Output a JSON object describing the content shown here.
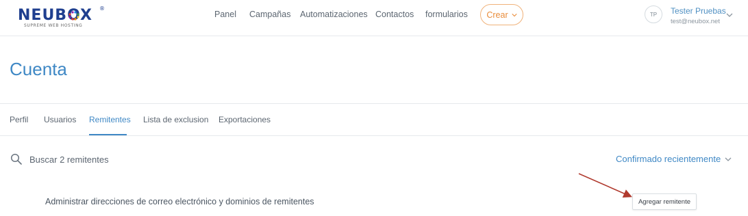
{
  "header": {
    "logo": {
      "text": "NEUBOX",
      "registered": "®",
      "tagline": "SUPREME WEB HOSTING"
    },
    "nav": [
      {
        "label": "Panel"
      },
      {
        "label": "Campañas"
      },
      {
        "label": "Automatizaciones"
      },
      {
        "label": "Contactos"
      },
      {
        "label": "formularios"
      }
    ],
    "create_button": {
      "label": "Crear",
      "icon": "chevron-down-icon"
    },
    "user": {
      "initials": "TP",
      "name": "Tester Pruebas",
      "email": "test@neubox.net",
      "menu_icon": "chevron-down-icon"
    }
  },
  "page": {
    "title": "Cuenta"
  },
  "tabs": [
    {
      "label": "Perfil",
      "active": false
    },
    {
      "label": "Usuarios",
      "active": false
    },
    {
      "label": "Remitentes",
      "active": true
    },
    {
      "label": "Lista de exclusion",
      "active": false
    },
    {
      "label": "Exportaciones",
      "active": false
    }
  ],
  "toolbar": {
    "search_placeholder": "Buscar 2 remitentes",
    "search_icon": "search-icon",
    "sort_label": "Confirmado recientemente",
    "sort_icon": "chevron-down-icon"
  },
  "senders": {
    "description": "Administrar direcciones de correo electrónico y dominios de remitentes",
    "add_button_label": "Agregar remitente"
  },
  "colors": {
    "accent": "#3f88c5",
    "create_button": "#e98c3a",
    "annotation_arrow": "#b03a2e"
  }
}
